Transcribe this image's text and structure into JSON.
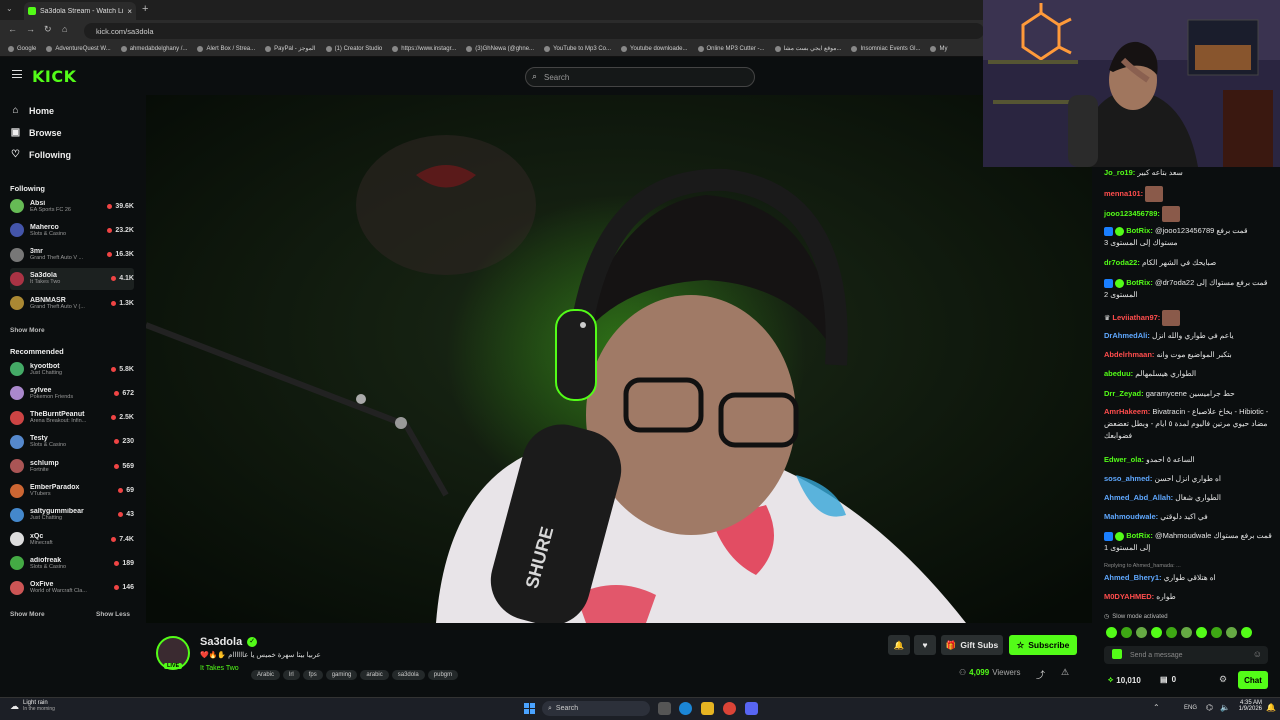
{
  "browser": {
    "tab_title": "Sa3dola Stream - Watch Live o",
    "url": "kick.com/sa3dola",
    "bookmarks": [
      "Google",
      "AdventureQuest W...",
      "ahmedabdelghany /...",
      "Alert Box / Strea...",
      "PayPal - الموجز",
      "(1) Creator Studio",
      "https://www.instagr...",
      "(3)GhNewa (@ghne...",
      "YouTube to Mp3 Co...",
      "Youtube downloade...",
      "Online MP3 Cutter -...",
      "موقع ايجي بست مشا...",
      "Insomniac Events Gl...",
      "My"
    ]
  },
  "header": {
    "logo": "KICK",
    "search_placeholder": "Search"
  },
  "sidebar": {
    "nav": [
      {
        "label": "Home",
        "icon": "home-icon"
      },
      {
        "label": "Browse",
        "icon": "browse-icon"
      },
      {
        "label": "Following",
        "icon": "heart-icon"
      }
    ],
    "following_title": "Following",
    "following": [
      {
        "name": "Absi",
        "category": "EA Sports FC 26",
        "viewers": "39.6K"
      },
      {
        "name": "Maherco",
        "category": "Slots & Casino",
        "viewers": "23.2K"
      },
      {
        "name": "3mr",
        "category": "Grand Theft Auto V ...",
        "viewers": "16.3K"
      },
      {
        "name": "Sa3dola",
        "category": "It Takes Two",
        "viewers": "4.1K"
      },
      {
        "name": "ABNMASR",
        "category": "Grand Theft Auto V (...",
        "viewers": "1.3K"
      }
    ],
    "show_more": "Show More",
    "recommended_title": "Recommended",
    "recommended": [
      {
        "name": "kyootbot",
        "category": "Just Chatting",
        "viewers": "5.8K"
      },
      {
        "name": "sylvee",
        "category": "Pokemon Friends",
        "viewers": "672"
      },
      {
        "name": "TheBurntPeanut",
        "category": "Arena Breakout: Infin...",
        "viewers": "2.5K"
      },
      {
        "name": "Testy",
        "category": "Slots & Casino",
        "viewers": "230"
      },
      {
        "name": "schlump",
        "category": "Fortnite",
        "viewers": "569"
      },
      {
        "name": "EmberParadox",
        "category": "VTubers",
        "viewers": "69"
      },
      {
        "name": "saltygummibear",
        "category": "Just Chatting",
        "viewers": "43"
      },
      {
        "name": "xQc",
        "category": "Minecraft",
        "viewers": "7.4K"
      },
      {
        "name": "adiofreak",
        "category": "Slots & Casino",
        "viewers": "189"
      },
      {
        "name": "OxFive",
        "category": "World of Warcraft Cla...",
        "viewers": "146"
      }
    ],
    "show_more2": "Show More",
    "show_less": "Show Less"
  },
  "stream": {
    "streamer": "Sa3dola",
    "live_badge": "LIVE",
    "title": "عربيا بيتا سهرة خميس يا عاااااام ✋🔥❤️",
    "category": "It Takes Two",
    "tags": [
      "Arabic",
      "lrl",
      "fps",
      "gaming",
      "arabic",
      "sa3dola",
      "pubgm"
    ],
    "gift_subs": "Gift Subs",
    "subscribe": "Subscribe",
    "viewers": "4,099",
    "viewers_label": "Viewers",
    "mic_brand": "SHURE"
  },
  "chat": {
    "messages": [
      {
        "user": "Jo_ro19:",
        "color": "#53fc18",
        "text": "سعد بتاعه كبير"
      },
      {
        "user": "menna101:",
        "color": "#ff4d4d",
        "text": ""
      },
      {
        "user": "jooo123456789:",
        "color": "#53fc18",
        "text": ""
      },
      {
        "user": "BotRix:",
        "color": "#53fc18",
        "text": "@jooo123456789 قمت برفع مستواك إلى المستوى 3"
      },
      {
        "user": "dr7oda22:",
        "color": "#53fc18",
        "text": "صبايحك في الشهر الكام"
      },
      {
        "user": "BotRix:",
        "color": "#53fc18",
        "text": "@dr7oda22 قمت برفع مستواك إلى المستوى 2"
      },
      {
        "user": "Leviiathan97:",
        "color": "#ff4d4d",
        "text": ""
      },
      {
        "user": "DrAhmedAli:",
        "color": "#5fa8ff",
        "text": "ياعم في طواري والله انزل"
      },
      {
        "user": "Abdelrhmaan:",
        "color": "#ff4d4d",
        "text": "بتكبر المواضيع موت وانه"
      },
      {
        "user": "abeduu:",
        "color": "#53fc18",
        "text": "الطواري هيسلمهالم"
      },
      {
        "user": "Drr_Zeyad:",
        "color": "#53fc18",
        "text": "حط جراميسين garamycene"
      },
      {
        "user": "AmrHakeem:",
        "color": "#ff4d4d",
        "text": "Bivatracin - بخاخ علاصباع - Hibiotic - مضاد حيوي مرتين فاليوم لمدة ٥ ايام - وبطل تعضعض فضوابعك"
      },
      {
        "user": "Edwer_ola:",
        "color": "#53fc18",
        "text": "الساعه ٥ احمدو"
      },
      {
        "user": "soso_ahmed:",
        "color": "#5fa8ff",
        "text": "اه طواري انزل احسن"
      },
      {
        "user": "Ahmed_Abd_Allah:",
        "color": "#5fa8ff",
        "text": "الطواري شغال"
      },
      {
        "user": "Mahmoudwale:",
        "color": "#5fa8ff",
        "text": "في اكيد دلوقتي"
      },
      {
        "user": "BotRix:",
        "color": "#53fc18",
        "text": "@Mahmoudwale قمت برفع مستواك إلى المستوى 1"
      },
      {
        "user": "Ahmed_Bhery1:",
        "color": "#5fa8ff",
        "text": "اه هتلاقي طواري"
      },
      {
        "user": "M0DYAHMED:",
        "color": "#ff4d4d",
        "text": "طواره"
      }
    ],
    "replying": "Replying to Ahmed_hamada: ...",
    "slow_mode": "Slow mode activated",
    "input_placeholder": "Send a message",
    "points": "10,010",
    "gifts": "0",
    "chat_button": "Chat"
  },
  "taskbar": {
    "weather_title": "Light rain",
    "weather_sub": "In the morning",
    "search": "Search",
    "lang": "ENG",
    "time": "4:35 AM",
    "date": "1/9/2026"
  }
}
